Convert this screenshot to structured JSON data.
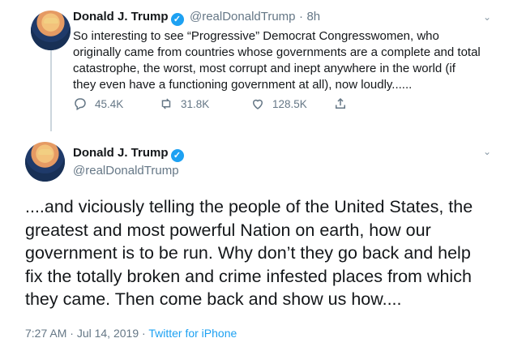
{
  "tweet1": {
    "name": "Donald J. Trump",
    "handle": "@realDonaldTrump",
    "separator": "·",
    "time": "8h",
    "text": "So interesting to see “Progressive” Democrat Congresswomen, who\noriginally came from countries whose governments are a complete and total\ncatastrophe, the worst, most corrupt and inept anywhere in the world (if\nthey even have a functioning government at all), now loudly......",
    "replies": "45.4K",
    "retweets": "31.8K",
    "likes": "128.5K"
  },
  "tweet2": {
    "name": "Donald J. Trump",
    "handle": "@realDonaldTrump",
    "text": "....and viciously telling the people of the United States, the\ngreatest and most powerful Nation on earth, how our\ngovernment is to be run. Why don’t they go back and help\nfix the totally broken and crime infested places from which\nthey came. Then come back and show us how....",
    "time": "7:27 AM",
    "separator": "·",
    "date": "Jul 14, 2019",
    "source": "Twitter for iPhone"
  },
  "icons": [
    "verified-badge-icon",
    "chevron-down-icon",
    "reply-icon",
    "retweet-icon",
    "like-icon",
    "share-icon"
  ],
  "colors": {
    "text": "#14171a",
    "secondary": "#657786",
    "accent": "#1da1f2",
    "thread": "#ccd6dd"
  }
}
